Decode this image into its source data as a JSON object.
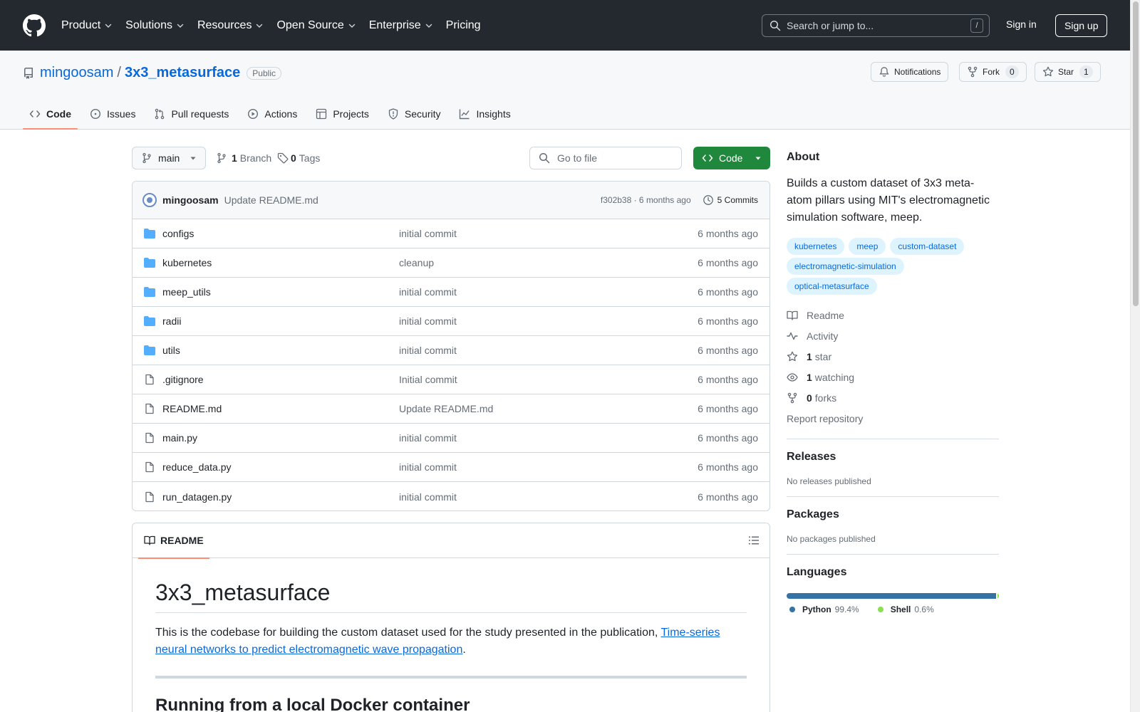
{
  "header": {
    "nav": [
      {
        "label": "Product",
        "dropdown": true
      },
      {
        "label": "Solutions",
        "dropdown": true
      },
      {
        "label": "Resources",
        "dropdown": true
      },
      {
        "label": "Open Source",
        "dropdown": true
      },
      {
        "label": "Enterprise",
        "dropdown": true
      },
      {
        "label": "Pricing",
        "dropdown": false
      }
    ],
    "search_placeholder": "Search or jump to...",
    "search_shortcut": "/",
    "sign_in": "Sign in",
    "sign_up": "Sign up"
  },
  "repo": {
    "owner": "mingoosam",
    "separator": "/",
    "name": "3x3_metasurface",
    "visibility": "Public",
    "notifications_label": "Notifications",
    "fork_label": "Fork",
    "fork_count": "0",
    "star_label": "Star",
    "star_count": "1"
  },
  "tabs": [
    {
      "label": "Code",
      "icon": "code-icon",
      "active": true
    },
    {
      "label": "Issues",
      "icon": "issue-icon",
      "active": false
    },
    {
      "label": "Pull requests",
      "icon": "pull-request-icon",
      "active": false
    },
    {
      "label": "Actions",
      "icon": "play-icon",
      "active": false
    },
    {
      "label": "Projects",
      "icon": "table-icon",
      "active": false
    },
    {
      "label": "Security",
      "icon": "shield-icon",
      "active": false
    },
    {
      "label": "Insights",
      "icon": "graph-icon",
      "active": false
    }
  ],
  "toolbar": {
    "branch": "main",
    "branch_count": "1",
    "branch_label": "Branch",
    "tag_count": "0",
    "tag_label": "Tags",
    "goto_placeholder": "Go to file",
    "code_button": "Code"
  },
  "latest_commit": {
    "author": "mingoosam",
    "message": "Update README.md",
    "meta": "f302b38 · 6 months ago",
    "commits": "5 Commits"
  },
  "files": [
    {
      "name": "configs",
      "type": "folder",
      "message": "initial commit",
      "date": "6 months ago"
    },
    {
      "name": "kubernetes",
      "type": "folder",
      "message": "cleanup",
      "date": "6 months ago"
    },
    {
      "name": "meep_utils",
      "type": "folder",
      "message": "initial commit",
      "date": "6 months ago"
    },
    {
      "name": "radii",
      "type": "folder",
      "message": "initial commit",
      "date": "6 months ago"
    },
    {
      "name": "utils",
      "type": "folder",
      "message": "initial commit",
      "date": "6 months ago"
    },
    {
      "name": ".gitignore",
      "type": "file",
      "message": "Initial commit",
      "date": "6 months ago"
    },
    {
      "name": "README.md",
      "type": "file",
      "message": "Update README.md",
      "date": "6 months ago"
    },
    {
      "name": "main.py",
      "type": "file",
      "message": "initial commit",
      "date": "6 months ago"
    },
    {
      "name": "reduce_data.py",
      "type": "file",
      "message": "initial commit",
      "date": "6 months ago"
    },
    {
      "name": "run_datagen.py",
      "type": "file",
      "message": "initial commit",
      "date": "6 months ago"
    }
  ],
  "readme": {
    "tab_label": "README",
    "h1": "3x3_metasurface",
    "intro": "This is the codebase for building the custom dataset used for the study presented in the publication, ",
    "link_text": "Time-series neural networks to predict electromagnetic wave propagation",
    "intro_end": ".",
    "h2": "Running from a local Docker container"
  },
  "sidebar": {
    "about_title": "About",
    "description": "Builds a custom dataset of 3x3 meta-atom pillars using MIT's electromagnetic simulation software, meep.",
    "topics": [
      "kubernetes",
      "meep",
      "custom-dataset",
      "electromagnetic-simulation",
      "optical-metasurface"
    ],
    "links": {
      "readme": "Readme",
      "activity": "Activity",
      "stars_count": "1",
      "stars_label": "star",
      "watching_count": "1",
      "watching_label": "watching",
      "forks_count": "0",
      "forks_label": "forks",
      "report": "Report repository"
    },
    "releases_title": "Releases",
    "releases_note": "No releases published",
    "packages_title": "Packages",
    "packages_note": "No packages published",
    "languages_title": "Languages",
    "languages": [
      {
        "name": "Python",
        "percent": "99.4%",
        "value": 99.4,
        "color": "#3572A5"
      },
      {
        "name": "Shell",
        "percent": "0.6%",
        "value": 0.6,
        "color": "#89e051"
      }
    ]
  },
  "colors": {
    "header_bg": "#24292f",
    "link": "#0969da",
    "accent_tab": "#fd8c73",
    "code_button": "#1f883d",
    "folder": "#54aeff"
  }
}
